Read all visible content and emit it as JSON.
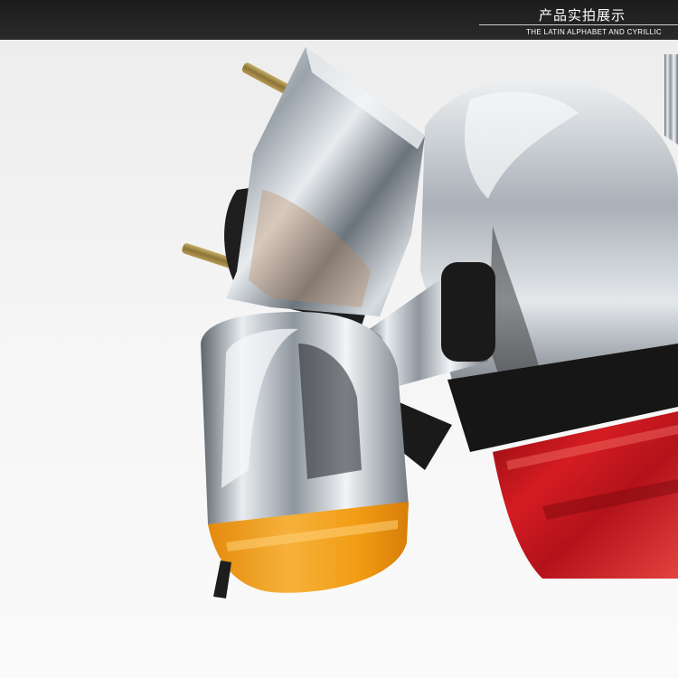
{
  "header": {
    "title": "产品实拍展示",
    "subtitle": "THE LATIN ALPHABET AND CYRILLIC"
  },
  "photo": {
    "subject": "chrome-turn-signals-and-tail-light"
  },
  "colors": {
    "header_bg": "#222222",
    "chrome": "#c9ced4",
    "amber_lens": "#f2a019",
    "red_lens": "#c0141b",
    "background": "#f4f4f4"
  }
}
